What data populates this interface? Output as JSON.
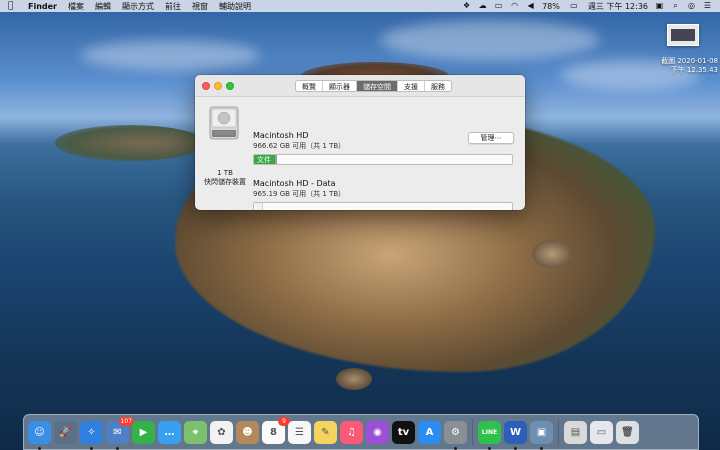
{
  "menubar": {
    "app_name": "Finder",
    "items": [
      "檔案",
      "編輯",
      "顯示方式",
      "前往",
      "視窗",
      "輔助說明"
    ],
    "battery": "78%",
    "clock": "週三 下午 12:36"
  },
  "screenshot_thumb": {
    "label_line1": "截圖 2020-01-08",
    "label_line2": "下午 12.35.43"
  },
  "window": {
    "tabs": [
      {
        "label": "概覽",
        "active": false
      },
      {
        "label": "顯示器",
        "active": false
      },
      {
        "label": "儲存空間",
        "active": true
      },
      {
        "label": "支援",
        "active": false
      },
      {
        "label": "服務",
        "active": false
      }
    ],
    "drive": {
      "size": "1 TB",
      "type": "快閃儲存裝置"
    },
    "manage_button": "管理⋯",
    "volumes": [
      {
        "name": "Macintosh HD",
        "available": "966.62 GB 可用（共 1 TB）",
        "segment_label": "文件",
        "used_fraction": 0.08,
        "color": "#39a845"
      },
      {
        "name": "Macintosh HD - Data",
        "available": "965.19 GB 可用（共 1 TB）",
        "used_fraction": 0.03
      }
    ]
  },
  "dock": {
    "apps": [
      {
        "name": "finder",
        "color": "#3a8ee6",
        "glyph": "☺",
        "running": true,
        "badge": ""
      },
      {
        "name": "launchpad",
        "color": "#5b6f86",
        "glyph": "🚀",
        "running": false,
        "badge": ""
      },
      {
        "name": "safari",
        "color": "#2f7fe0",
        "glyph": "✧",
        "running": true,
        "badge": ""
      },
      {
        "name": "mail",
        "color": "#4f7fc4",
        "glyph": "✉",
        "running": true,
        "badge": "107"
      },
      {
        "name": "facetime",
        "color": "#33b24a",
        "glyph": "▶",
        "running": false,
        "badge": ""
      },
      {
        "name": "messages",
        "color": "#38a0f0",
        "glyph": "…",
        "running": false,
        "badge": ""
      },
      {
        "name": "maps",
        "color": "#7cc16c",
        "glyph": "⌖",
        "running": false,
        "badge": ""
      },
      {
        "name": "photos",
        "color": "#f2f2f2",
        "glyph": "✿",
        "running": false,
        "badge": ""
      },
      {
        "name": "contacts",
        "color": "#b28a5a",
        "glyph": "☻",
        "running": false,
        "badge": ""
      },
      {
        "name": "calendar",
        "color": "#fbfbfb",
        "glyph": "8",
        "running": false,
        "badge": "9"
      },
      {
        "name": "reminders",
        "color": "#f7f7f7",
        "glyph": "☰",
        "running": false,
        "badge": ""
      },
      {
        "name": "notes",
        "color": "#f4d35e",
        "glyph": "✎",
        "running": false,
        "badge": ""
      },
      {
        "name": "music",
        "color": "#fa5a75",
        "glyph": "♫",
        "running": false,
        "badge": ""
      },
      {
        "name": "podcasts",
        "color": "#9b4fd6",
        "glyph": "◉",
        "running": false,
        "badge": ""
      },
      {
        "name": "tv",
        "color": "#111111",
        "glyph": "tv",
        "running": false,
        "badge": ""
      },
      {
        "name": "app-store",
        "color": "#2b8df0",
        "glyph": "A",
        "running": false,
        "badge": ""
      },
      {
        "name": "system-preferences",
        "color": "#8a8f96",
        "glyph": "⚙",
        "running": true,
        "badge": ""
      },
      {
        "name": "line",
        "color": "#2fc14d",
        "glyph": "LINE",
        "running": true,
        "badge": ""
      },
      {
        "name": "word",
        "color": "#2b5fb8",
        "glyph": "W",
        "running": true,
        "badge": ""
      },
      {
        "name": "preview",
        "color": "#6e8fb4",
        "glyph": "▣",
        "running": true,
        "badge": ""
      },
      {
        "name": "scanner",
        "color": "#d9d9d9",
        "glyph": "▤",
        "running": false,
        "badge": ""
      },
      {
        "name": "screenshot-stack",
        "color": "#e4e8ee",
        "glyph": "▭",
        "running": false,
        "badge": ""
      },
      {
        "name": "trash",
        "color": "#dcdfe3",
        "glyph": "🗑",
        "running": false,
        "badge": ""
      }
    ]
  }
}
